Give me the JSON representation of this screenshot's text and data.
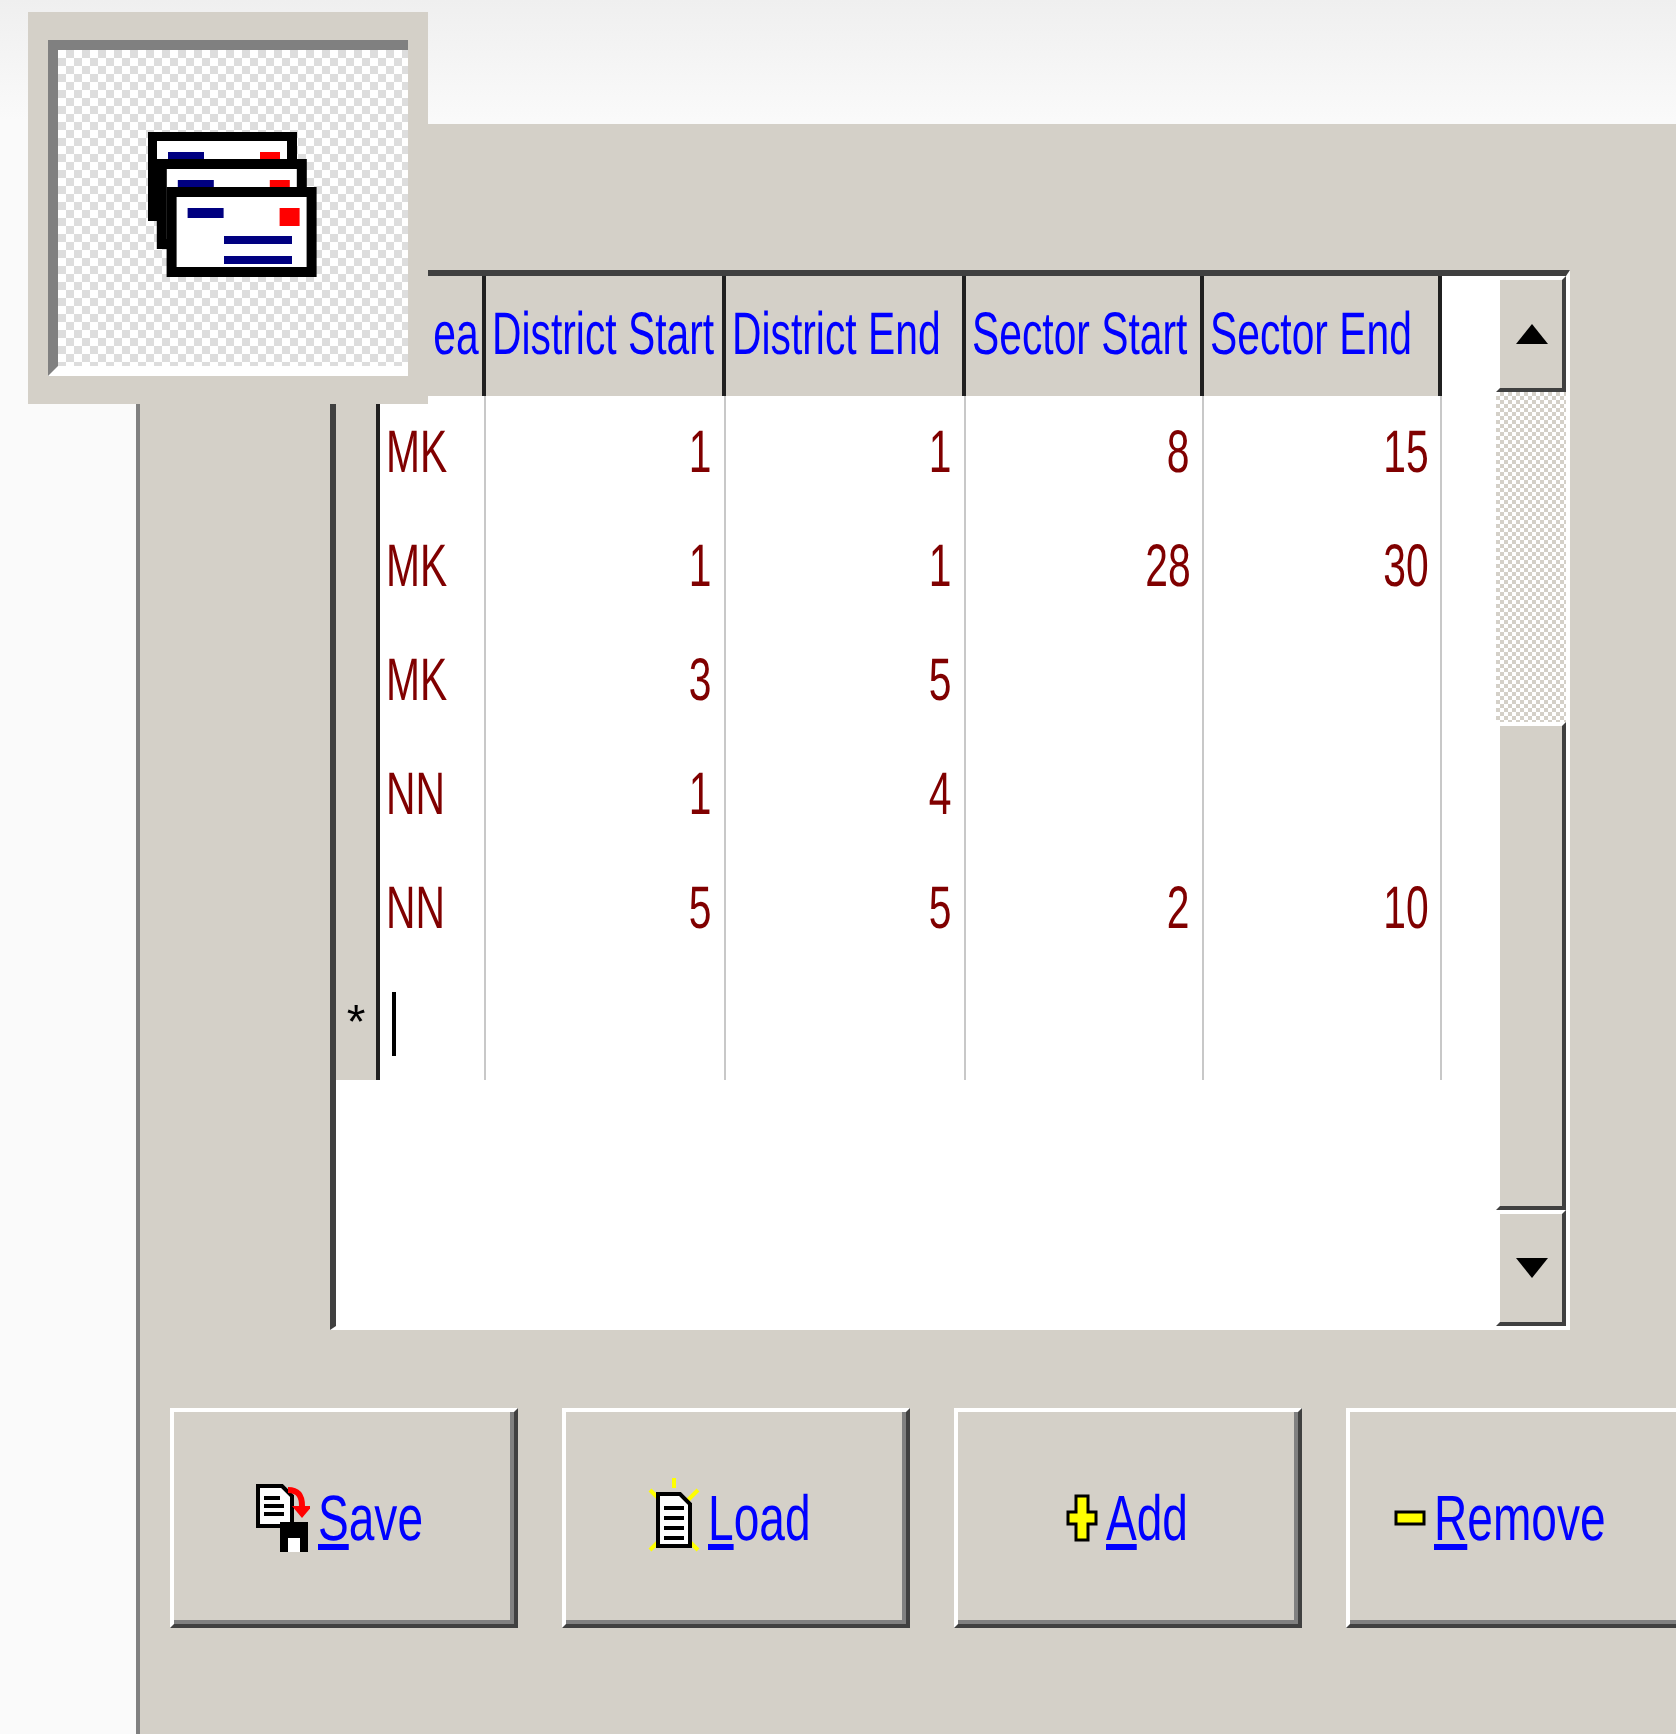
{
  "grid": {
    "columns": [
      "ea",
      "District Start",
      "District End",
      "Sector Start",
      "Sector End"
    ],
    "rows": [
      [
        "MK",
        "1",
        "1",
        "8",
        "15"
      ],
      [
        "MK",
        "1",
        "1",
        "28",
        "30"
      ],
      [
        "MK",
        "3",
        "5",
        "",
        ""
      ],
      [
        "NN",
        "1",
        "4",
        "",
        ""
      ],
      [
        "NN",
        "5",
        "5",
        "2",
        "10"
      ]
    ],
    "new_row_marker": "*"
  },
  "buttons": [
    {
      "label": "Save",
      "kind": "save"
    },
    {
      "label": "Load",
      "kind": "load"
    },
    {
      "label": "Add",
      "kind": "add"
    },
    {
      "label": "Remove",
      "kind": "remove"
    }
  ]
}
